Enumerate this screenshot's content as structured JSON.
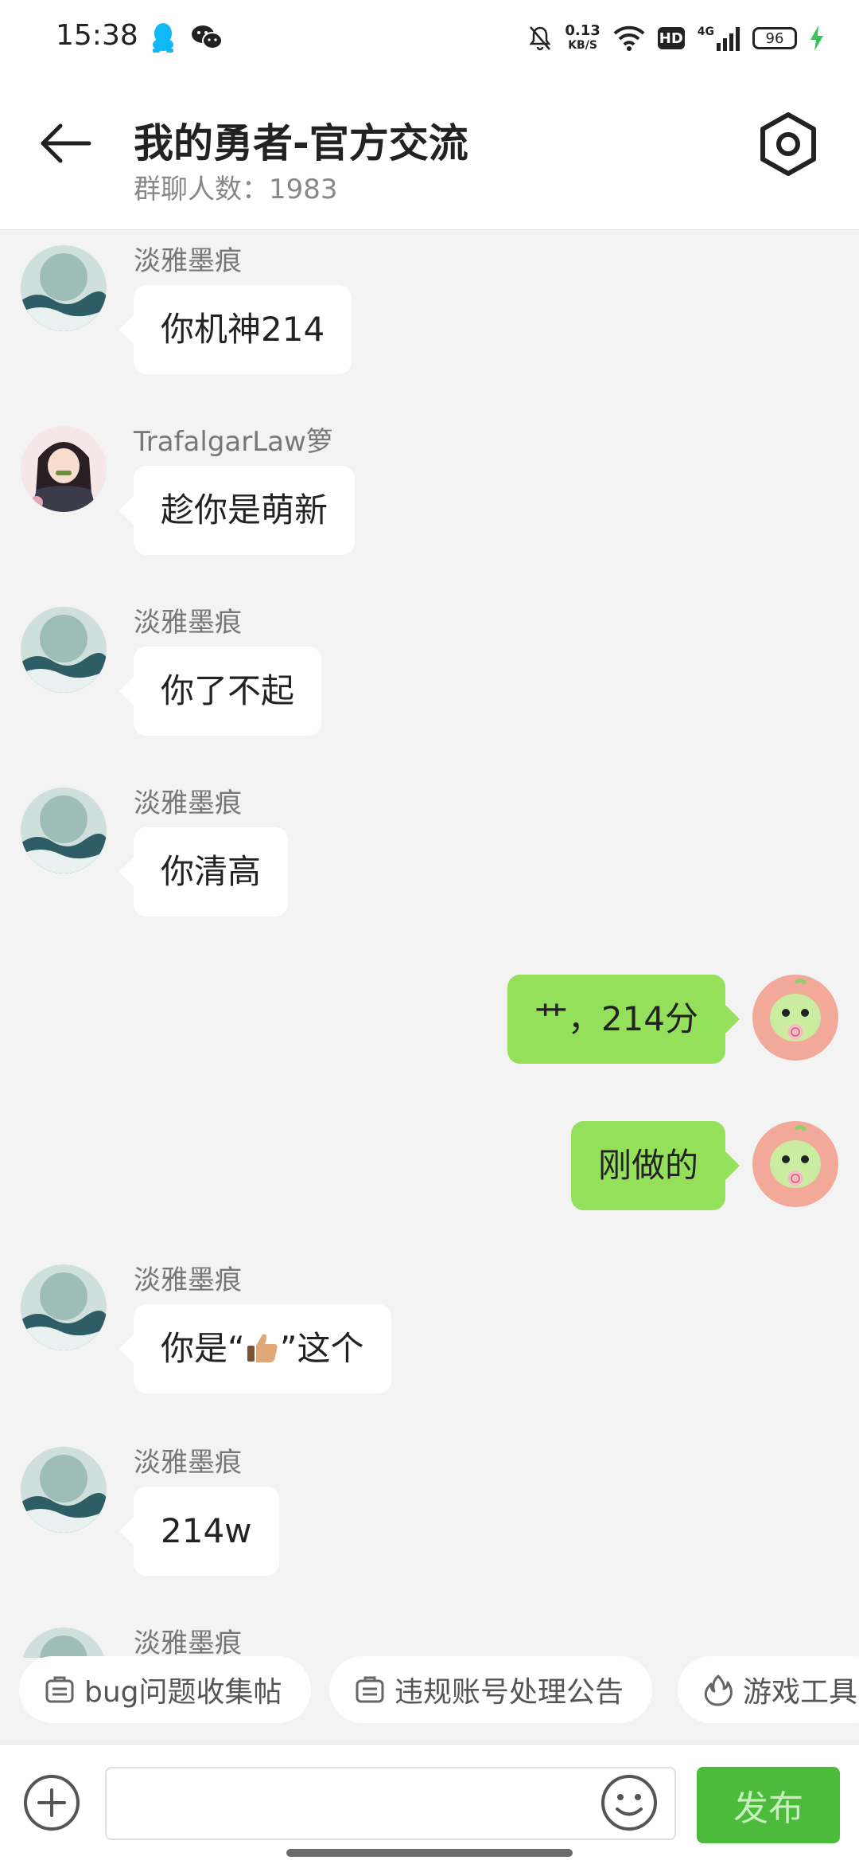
{
  "status_bar": {
    "time": "15:38",
    "net_speed_value": "0.13",
    "net_speed_unit": "KB/S",
    "hd": "HD",
    "signal": "4G",
    "battery": "96"
  },
  "header": {
    "title": "我的勇者-官方交流",
    "subtitle": "群聊人数：1983"
  },
  "messages": [
    {
      "sender": "淡雅墨痕",
      "text": "你机神214",
      "side": "left"
    },
    {
      "sender": "TrafalgarLaw箩",
      "text": "趁你是萌新",
      "side": "left"
    },
    {
      "sender": "淡雅墨痕",
      "text": "你了不起",
      "side": "left"
    },
    {
      "sender": "淡雅墨痕",
      "text": "你清高",
      "side": "left"
    },
    {
      "sender": "",
      "text": "艹，214分",
      "side": "right"
    },
    {
      "sender": "",
      "text": "刚做的",
      "side": "right"
    },
    {
      "sender": "淡雅墨痕",
      "text_before": "你是“",
      "text_after": "”这个",
      "emoji": "thumbs-up",
      "side": "left"
    },
    {
      "sender": "淡雅墨痕",
      "text": "214w",
      "side": "left"
    },
    {
      "sender": "淡雅墨痕",
      "text": "",
      "side": "left"
    }
  ],
  "chips": [
    {
      "label": "bug问题收集帖",
      "icon": "post-icon"
    },
    {
      "label": "违规账号处理公告",
      "icon": "post-icon"
    },
    {
      "label": "游戏工具",
      "icon": "flame-icon"
    }
  ],
  "input": {
    "placeholder": ""
  },
  "send_label": "发布",
  "colors": {
    "accent": "#4cbb3c",
    "own_bubble": "#95e05b",
    "background": "#f3f3f3"
  }
}
